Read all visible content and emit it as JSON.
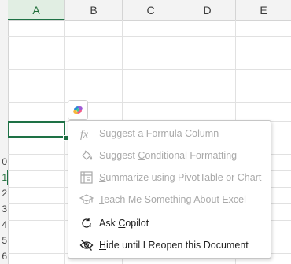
{
  "columns": [
    {
      "label": "A",
      "selected": true
    },
    {
      "label": "B",
      "selected": false
    },
    {
      "label": "C",
      "selected": false
    },
    {
      "label": "D",
      "selected": false
    },
    {
      "label": "E",
      "selected": false
    }
  ],
  "rows": [
    "0",
    "1",
    "2",
    "3",
    "4",
    "5",
    "6"
  ],
  "menu": {
    "items": [
      {
        "pre": "Suggest a ",
        "key": "F",
        "post": "ormula Column",
        "enabled": false,
        "icon": "fx-icon"
      },
      {
        "pre": "Suggest ",
        "key": "C",
        "post": "onditional Formatting",
        "enabled": false,
        "icon": "paint-bucket-icon"
      },
      {
        "pre": "",
        "key": "S",
        "post": "ummarize using PivotTable or Chart",
        "enabled": false,
        "icon": "pivot-table-icon"
      },
      {
        "pre": "",
        "key": "T",
        "post": "each Me Something About Excel",
        "enabled": false,
        "icon": "graduation-cap-icon"
      },
      {
        "pre": "Ask ",
        "key": "C",
        "post": "opilot",
        "enabled": true,
        "icon": "copilot-refresh-icon"
      },
      {
        "pre": "",
        "key": "H",
        "post": "ide until I Reopen this Document",
        "enabled": true,
        "icon": "eye-off-icon"
      }
    ]
  },
  "colors": {
    "accent": "#1e7145",
    "disabled_text": "#a9a9a9",
    "enabled_text": "#1f1f1f"
  }
}
